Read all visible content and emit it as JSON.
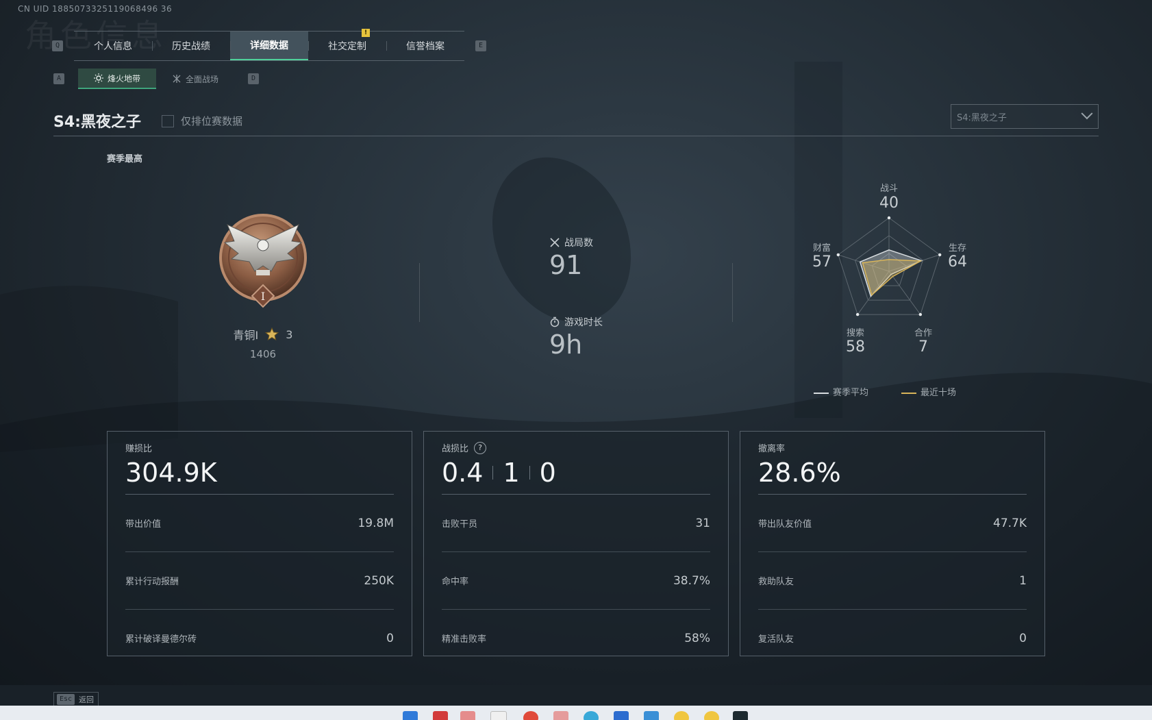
{
  "uid": "CN UID 1885073325119068496 36",
  "ghost_title": "角色信息",
  "tabs": {
    "left_key": "Q",
    "right_key": "E",
    "items": [
      {
        "label": "个人信息"
      },
      {
        "label": "历史战绩"
      },
      {
        "label": "详细数据"
      },
      {
        "label": "社交定制"
      },
      {
        "label": "信誉档案"
      }
    ],
    "notice_badge": "!"
  },
  "subtabs": {
    "left_key": "A",
    "right_key": "D",
    "items": [
      {
        "label": "烽火地带"
      },
      {
        "label": "全面战场"
      }
    ]
  },
  "season": {
    "title": "S4:黑夜之子",
    "ranked_only_label": "仅排位赛数据",
    "select_value": "S4:黑夜之子"
  },
  "season_high_label": "赛季最高",
  "rank": {
    "name": "青铜I",
    "stars": "3",
    "score": "1406",
    "emblem_numeral": "I"
  },
  "stats": {
    "matches_label": "战局数",
    "matches_value": "91",
    "playtime_label": "游戏时长",
    "playtime_value": "9h"
  },
  "radar": {
    "axes": [
      {
        "label": "战斗",
        "value": "40"
      },
      {
        "label": "生存",
        "value": "64"
      },
      {
        "label": "合作",
        "value": "7"
      },
      {
        "label": "搜索",
        "value": "58"
      },
      {
        "label": "财富",
        "value": "57"
      }
    ],
    "season_avg": [
      0.4,
      0.64,
      0.07,
      0.58,
      0.57
    ],
    "recent_ten": [
      0.22,
      0.62,
      0.12,
      0.55,
      0.52
    ],
    "legend": [
      {
        "label": "赛季平均",
        "color": "#d8dde0"
      },
      {
        "label": "最近十场",
        "color": "#d9b55a"
      }
    ]
  },
  "cards": [
    {
      "title": "赚损比",
      "big": "304.9K",
      "rows": [
        {
          "label": "带出价值",
          "value": "19.8M"
        },
        {
          "label": "累计行动报酬",
          "value": "250K"
        },
        {
          "label": "累计破译曼德尔砖",
          "value": "0"
        }
      ]
    },
    {
      "title": "战损比",
      "help": "?",
      "big_parts": [
        "0.4",
        "1",
        "0"
      ],
      "rows": [
        {
          "label": "击败干员",
          "value": "31"
        },
        {
          "label": "命中率",
          "value": "38.7%"
        },
        {
          "label": "精准击败率",
          "value": "58%"
        }
      ]
    },
    {
      "title": "撤离率",
      "big": "28.6%",
      "rows": [
        {
          "label": "带出队友价值",
          "value": "47.7K"
        },
        {
          "label": "救助队友",
          "value": "1"
        },
        {
          "label": "复活队友",
          "value": "0"
        }
      ]
    }
  ],
  "footer": {
    "esc_key": "Esc",
    "back_label": "返回"
  },
  "colors": {
    "accent_green": "#4fd19a",
    "gold": "#d9b55a"
  }
}
